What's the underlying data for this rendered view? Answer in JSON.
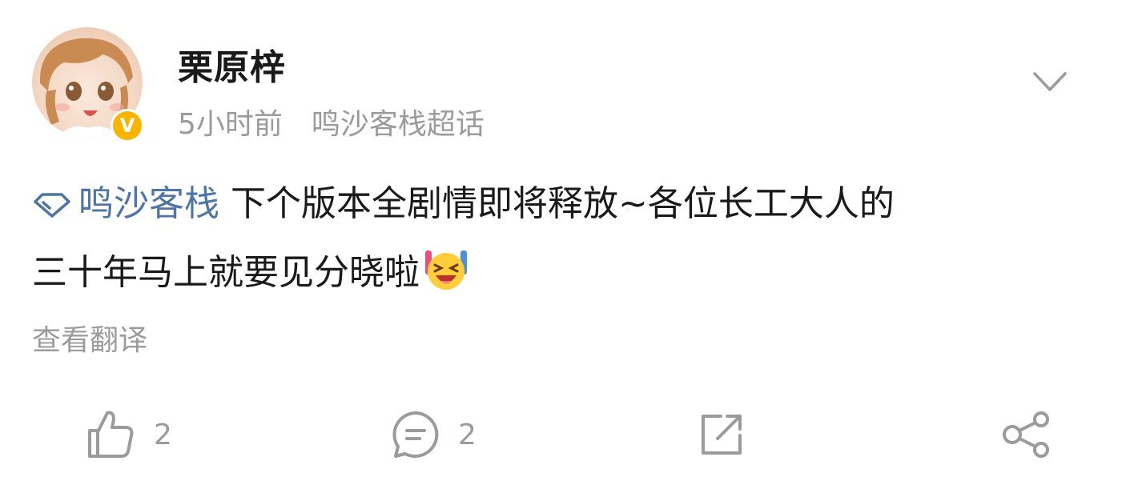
{
  "post": {
    "username": "栗原梓",
    "verified_badge": "V",
    "time": "5小时前",
    "source": "鸣沙客栈超话",
    "topic": "鸣沙客栈",
    "text_line1": "下个版本全剧情即将释放~各位长工大人的",
    "text_line2": "三十年马上就要见分晓啦",
    "translate_label": "查看翻译"
  },
  "actions": {
    "like_count": "2",
    "comment_count": "2"
  },
  "icons": {
    "more": "chevron-down-icon",
    "topic": "super-topic-diamond-icon",
    "emoji": "laughing-emoji",
    "like": "thumbs-up-icon",
    "comment": "comment-bubble-icon",
    "repost": "repost-icon",
    "share": "share-icon"
  },
  "colors": {
    "topic_link": "#4f74a8",
    "secondary_text": "#9b9b9b",
    "verified_badge": "#f7b500"
  }
}
